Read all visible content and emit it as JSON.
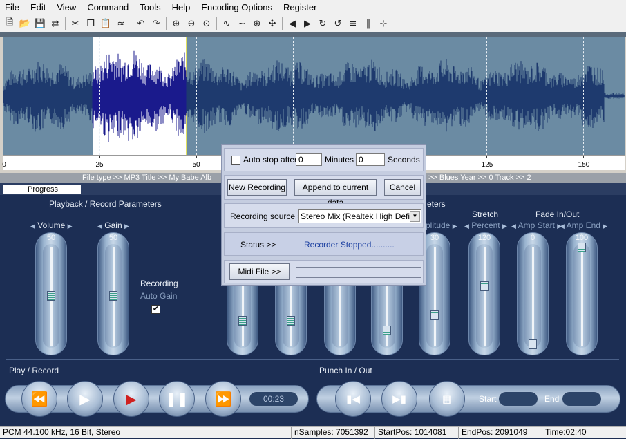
{
  "menu": [
    "File",
    "Edit",
    "View",
    "Command",
    "Tools",
    "Help",
    "Encoding Options",
    "Register"
  ],
  "toolbar_icons": [
    "new-file",
    "open-folder",
    "save",
    "batch-convert",
    "cut",
    "copy",
    "paste",
    "mix-paste",
    "undo",
    "redo",
    "zoom-in",
    "zoom-out",
    "zoom-fit",
    "waveform",
    "silence",
    "cursor-cross",
    "split",
    "fade-left",
    "fade-right",
    "loop",
    "reverse",
    "normalize",
    "channels",
    "spectrum"
  ],
  "ruler_ticks": [
    "0",
    "25",
    "50",
    "125",
    "150"
  ],
  "info_bar": {
    "left": "File type >> MP3    Title >> My Babe    Alb",
    "right": ">> Blues    Year >> 0    Track >> 2"
  },
  "progress_tab": "Progress",
  "left_panel": {
    "title": "Playback / Record Parameters",
    "volume_label": "Volume",
    "volume_value": "50",
    "gain_label": "Gain",
    "gain_value": "50",
    "recording_label": "Recording",
    "auto_gain_label": "Auto Gain",
    "auto_gain_checked": "✔"
  },
  "right_panel": {
    "title_partial": "eters",
    "amplitude_label": "mplitude",
    "amplitude_value": "30",
    "stretch_label": "Stretch",
    "percent_label": "Percent",
    "percent_value": "120",
    "fade_label": "Fade In/Out",
    "amp_start_label": "Amp Start",
    "amp_start_value": "0",
    "amp_end_label": "Amp End",
    "amp_end_value": "100"
  },
  "play_record": {
    "title": "Play / Record",
    "time": "00:23"
  },
  "punch": {
    "title": "Punch In / Out",
    "start_label": "Start",
    "end_label": "End"
  },
  "status_bar": {
    "format": "PCM 44.100 kHz, 16 Bit, Stereo",
    "nsamples": "nSamples: 7051392",
    "startpos": "StartPos: 1014081",
    "endpos": "EndPos: 2091049",
    "time": "Time:02:40"
  },
  "dialog": {
    "auto_stop_label": "Auto stop after",
    "minutes_value": "0",
    "minutes_label": "Minutes",
    "seconds_value": "0",
    "seconds_label": "Seconds",
    "new_recording": "New Recording",
    "append": "Append to current data",
    "cancel": "Cancel",
    "source_label": "Recording source =",
    "source_value": "Stereo Mix (Realtek High Defini",
    "status_label": "Status >>",
    "status_value": "Recorder Stopped..........",
    "midi_button": "Midi File >>"
  },
  "colors": {
    "wave_bg": "#6b8ba3",
    "wave_line": "#1e3a6e",
    "selection_wave": "#1a1a8c",
    "panel_bg": "#1c2e54"
  }
}
